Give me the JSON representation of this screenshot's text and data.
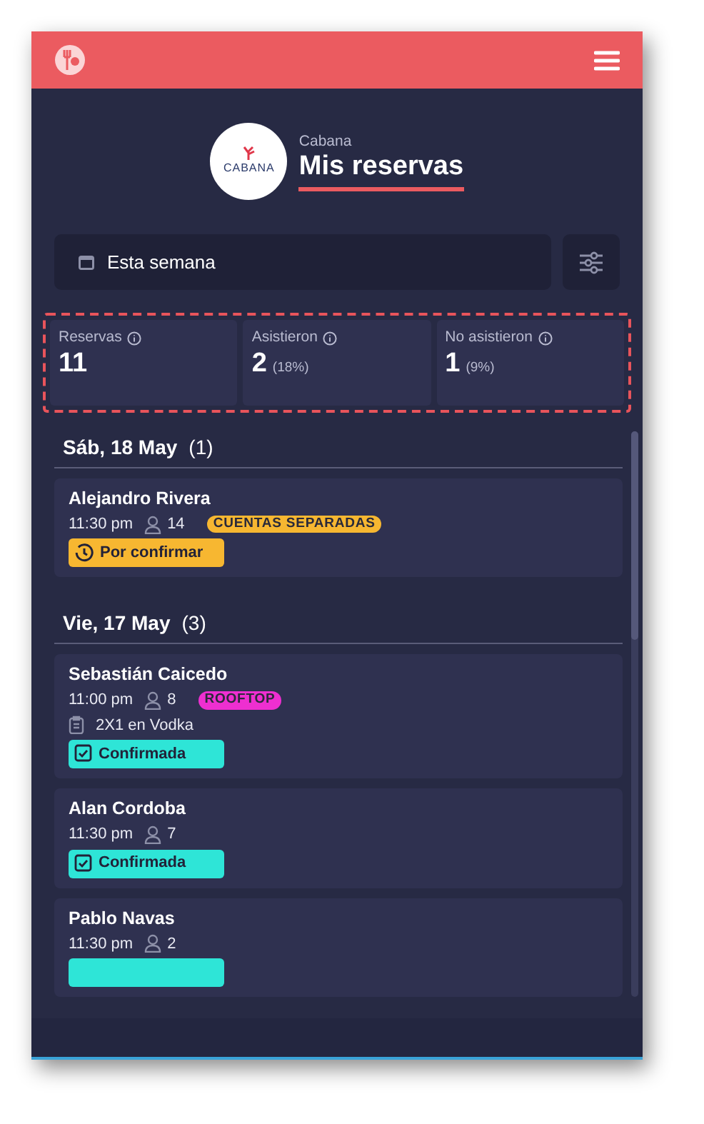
{
  "venue": {
    "name": "Cabana",
    "logo_text": "CABANA"
  },
  "title": "Mis reservas",
  "date_filter": {
    "value": "Esta semana"
  },
  "stats": [
    {
      "label": "Reservas",
      "value": "11"
    },
    {
      "label": "Asistieron",
      "value": "2",
      "percent": "(18%)"
    },
    {
      "label": "No asistieron",
      "value": "1",
      "percent": "(9%)"
    }
  ],
  "days": [
    {
      "date": "Sáb, 18 May",
      "count": "(1)",
      "reservations": [
        {
          "name": "Alejandro Rivera",
          "time": "11:30 pm",
          "guests": "14",
          "tag": {
            "label": "CUENTAS SEPARADAS",
            "color": "#f7b731"
          },
          "status": {
            "kind": "pending",
            "label": "Por confirmar"
          }
        }
      ]
    },
    {
      "date": "Vie, 17 May",
      "count": "(3)",
      "reservations": [
        {
          "name": "Sebastián Caicedo",
          "time": "11:00 pm",
          "guests": "8",
          "tag": {
            "label": "ROOFTOP",
            "color": "#ee2fd0"
          },
          "note": "2X1 en Vodka",
          "status": {
            "kind": "confirmed",
            "label": "Confirmada"
          }
        },
        {
          "name": "Alan Cordoba",
          "time": "11:30 pm",
          "guests": "7",
          "status": {
            "kind": "confirmed",
            "label": "Confirmada"
          }
        },
        {
          "name": "Pablo Navas",
          "time": "11:30 pm",
          "guests": "2",
          "status": {
            "kind": "confirmed"
          }
        }
      ]
    }
  ]
}
